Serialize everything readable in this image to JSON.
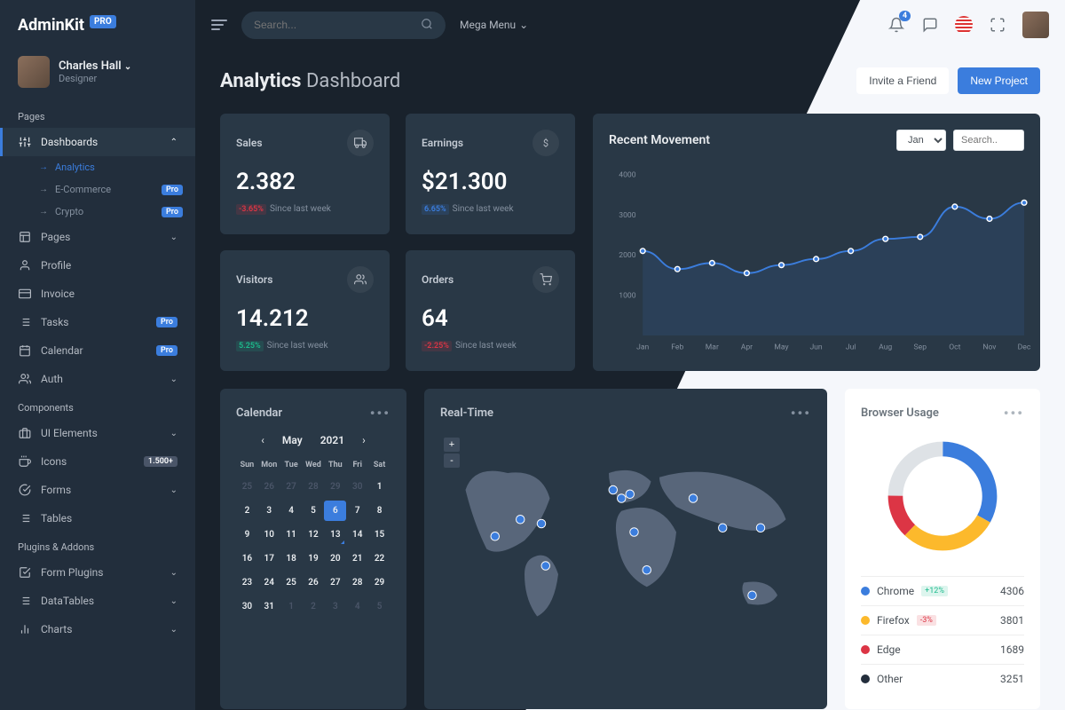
{
  "brand": {
    "name": "AdminKit",
    "badge": "PRO"
  },
  "user": {
    "name": "Charles Hall",
    "role": "Designer"
  },
  "topbar": {
    "search_placeholder": "Search...",
    "mega_label": "Mega Menu",
    "notifications_badge": "4"
  },
  "sidebar": {
    "sections": {
      "pages": "Pages",
      "components": "Components",
      "plugins": "Plugins & Addons"
    },
    "dashboards": {
      "label": "Dashboards",
      "sub": [
        {
          "label": "Analytics",
          "active": true
        },
        {
          "label": "E-Commerce",
          "badge": "Pro"
        },
        {
          "label": "Crypto",
          "badge": "Pro"
        }
      ]
    },
    "pages_item": "Pages",
    "profile": "Profile",
    "invoice": "Invoice",
    "tasks": {
      "label": "Tasks",
      "badge": "Pro"
    },
    "calendar": {
      "label": "Calendar",
      "badge": "Pro"
    },
    "auth": "Auth",
    "ui": "UI Elements",
    "icons": {
      "label": "Icons",
      "badge": "1.500+"
    },
    "forms": "Forms",
    "tables": "Tables",
    "form_plugins": "Form Plugins",
    "datatables": "DataTables",
    "charts": "Charts"
  },
  "page": {
    "title_bold": "Analytics",
    "title_rest": "Dashboard",
    "invite": "Invite a Friend",
    "new_project": "New Project"
  },
  "kpi": {
    "sales": {
      "label": "Sales",
      "value": "2.382",
      "pct": "-3.65%",
      "note": "Since last week",
      "dir": "down"
    },
    "earnings": {
      "label": "Earnings",
      "value": "$21.300",
      "pct": "6.65%",
      "note": "Since last week",
      "dir": "primary"
    },
    "visitors": {
      "label": "Visitors",
      "value": "14.212",
      "pct": "5.25%",
      "note": "Since last week",
      "dir": "up"
    },
    "orders": {
      "label": "Orders",
      "value": "64",
      "pct": "-2.25%",
      "note": "Since last week",
      "dir": "down"
    }
  },
  "movement": {
    "title": "Recent Movement",
    "month": "Jan",
    "search_placeholder": "Search.."
  },
  "calendar": {
    "title": "Calendar",
    "month": "May",
    "year": "2021",
    "days": [
      "Sun",
      "Mon",
      "Tue",
      "Wed",
      "Thu",
      "Fri",
      "Sat"
    ],
    "grid": [
      [
        25,
        26,
        27,
        28,
        29,
        30,
        1
      ],
      [
        2,
        3,
        4,
        5,
        6,
        7,
        8
      ],
      [
        9,
        10,
        11,
        12,
        13,
        14,
        15
      ],
      [
        16,
        17,
        18,
        19,
        20,
        21,
        22
      ],
      [
        23,
        24,
        25,
        26,
        27,
        28,
        29
      ],
      [
        30,
        31,
        1,
        2,
        3,
        4,
        5
      ]
    ],
    "active_day": 6,
    "dot_days": [
      13
    ]
  },
  "realtime": {
    "title": "Real-Time",
    "plus": "+",
    "minus": "-"
  },
  "browser": {
    "title": "Browser Usage",
    "rows": [
      {
        "name": "Chrome",
        "change": "+12%",
        "dir": "up",
        "value": "4306",
        "color": "#3b7ddd"
      },
      {
        "name": "Firefox",
        "change": "-3%",
        "dir": "down",
        "value": "3801",
        "color": "#fcb92c"
      },
      {
        "name": "Edge",
        "change": "",
        "dir": "",
        "value": "1689",
        "color": "#dc3545"
      },
      {
        "name": "Other",
        "change": "",
        "dir": "",
        "value": "3251",
        "color": "#232e3c"
      }
    ]
  },
  "chart_data": {
    "movement": {
      "type": "line",
      "title": "Recent Movement",
      "xlabel": "",
      "ylabel": "",
      "ylim": [
        0,
        4000
      ],
      "yticks": [
        1000,
        2000,
        3000,
        4000
      ],
      "categories": [
        "Jan",
        "Feb",
        "Mar",
        "Apr",
        "May",
        "Jun",
        "Jul",
        "Aug",
        "Sep",
        "Oct",
        "Nov",
        "Dec"
      ],
      "values": [
        2100,
        1650,
        1800,
        1550,
        1750,
        1900,
        2100,
        2400,
        2450,
        3200,
        2900,
        3300
      ]
    },
    "browser_usage": {
      "type": "pie",
      "title": "Browser Usage",
      "series": [
        {
          "name": "Chrome",
          "value": 4306,
          "color": "#3b7ddd"
        },
        {
          "name": "Firefox",
          "value": 3801,
          "color": "#fcb92c"
        },
        {
          "name": "Edge",
          "value": 1689,
          "color": "#dc3545"
        },
        {
          "name": "Other",
          "value": 3251,
          "color": "#dee2e6"
        }
      ]
    }
  }
}
